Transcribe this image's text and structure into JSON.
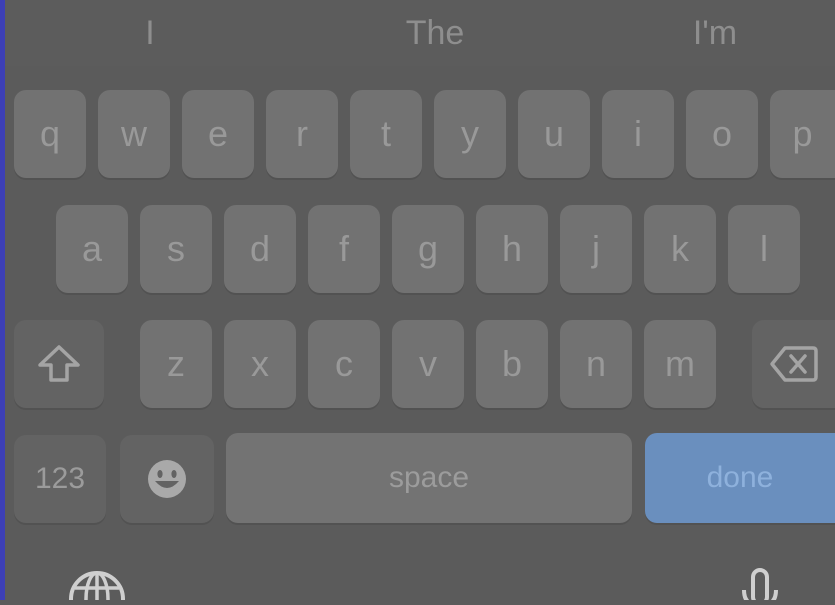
{
  "suggestions": [
    "I",
    "The",
    "I'm"
  ],
  "rows": {
    "row1": [
      "q",
      "w",
      "e",
      "r",
      "t",
      "y",
      "u",
      "i",
      "o",
      "p"
    ],
    "row2": [
      "a",
      "s",
      "d",
      "f",
      "g",
      "h",
      "j",
      "k",
      "l"
    ],
    "row3": [
      "z",
      "x",
      "c",
      "v",
      "b",
      "n",
      "m"
    ]
  },
  "keys": {
    "numbers": "123",
    "space": "space",
    "done": "done"
  },
  "icons": {
    "shift": "shift-icon",
    "delete": "delete-icon",
    "emoji": "emoji-icon",
    "globe": "globe-icon",
    "mic": "microphone-icon"
  },
  "colors": {
    "keyboard_bg": "#5b5b5b",
    "key_bg": "#727272",
    "done_bg": "#6a8fbe"
  }
}
